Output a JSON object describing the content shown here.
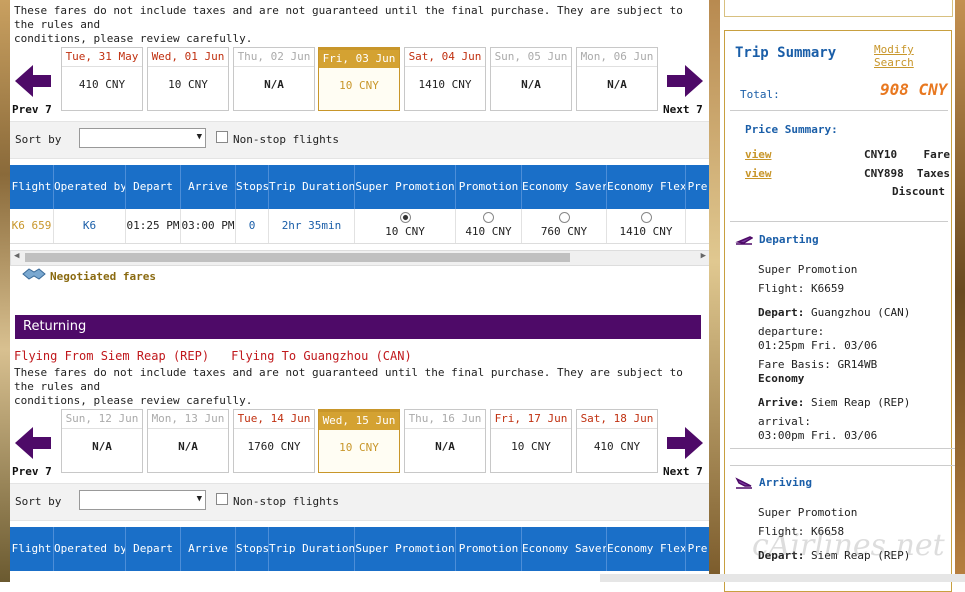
{
  "notice": {
    "line1": "These fares do not include taxes and are not guaranteed until the final purchase. They are subject to the rules and",
    "line2": "conditions, please review carefully."
  },
  "nav": {
    "prev": "Prev 7",
    "next": "Next 7"
  },
  "departing_dates": [
    {
      "date": "Tue, 31 May",
      "price": "410 CNY",
      "available": true,
      "selected": false
    },
    {
      "date": "Wed, 01 Jun",
      "price": "10 CNY",
      "available": true,
      "selected": false
    },
    {
      "date": "Thu, 02 Jun",
      "price": "N/A",
      "available": false,
      "selected": false
    },
    {
      "date": "Fri, 03 Jun",
      "price": "10 CNY",
      "available": true,
      "selected": true
    },
    {
      "date": "Sat, 04 Jun",
      "price": "1410 CNY",
      "available": true,
      "selected": false
    },
    {
      "date": "Sun, 05 Jun",
      "price": "N/A",
      "available": false,
      "selected": false
    },
    {
      "date": "Mon, 06 Jun",
      "price": "N/A",
      "available": false,
      "selected": false
    }
  ],
  "returning_dates": [
    {
      "date": "Sun, 12 Jun",
      "price": "N/A",
      "available": false,
      "selected": false
    },
    {
      "date": "Mon, 13 Jun",
      "price": "N/A",
      "available": false,
      "selected": false
    },
    {
      "date": "Tue, 14 Jun",
      "price": "1760 CNY",
      "available": true,
      "selected": false
    },
    {
      "date": "Wed, 15 Jun",
      "price": "10 CNY",
      "available": true,
      "selected": true
    },
    {
      "date": "Thu, 16 Jun",
      "price": "N/A",
      "available": false,
      "selected": false
    },
    {
      "date": "Fri, 17 Jun",
      "price": "10 CNY",
      "available": true,
      "selected": false
    },
    {
      "date": "Sat, 18 Jun",
      "price": "410 CNY",
      "available": true,
      "selected": false
    }
  ],
  "sort": {
    "label": "Sort by",
    "value": "",
    "nonstop_label": "Non-stop flights"
  },
  "table": {
    "headers": [
      "Flight",
      "Operated by",
      "Depart",
      "Arrive",
      "Stops",
      "Trip Duration",
      "Super Promotion",
      "Promotion",
      "Economy Saver",
      "Economy Flex",
      "Pre"
    ]
  },
  "flight": {
    "flight": "K6 659",
    "operated_by": "K6",
    "depart": "01:25 PM",
    "arrive": "03:00 PM",
    "stops": "0",
    "duration": "2hr 35min",
    "fares": [
      "10 CNY",
      "410 CNY",
      "760 CNY",
      "1410 CNY"
    ],
    "selected_fare": 0
  },
  "negotiated": "Negotiated fares",
  "returning": {
    "title": "Returning",
    "from": "Flying From Siem Reap (REP)",
    "to": "Flying To Guangzhou (CAN)"
  },
  "summary": {
    "title": "Trip Summary",
    "modify": "Modify Search",
    "total_label": "Total:",
    "total_value": "908 CNY",
    "price_title": "Price Summary:",
    "rows": [
      {
        "view": "view",
        "amount": "CNY10",
        "label": "Fare"
      },
      {
        "view": "view",
        "amount": "CNY898",
        "label": "Taxes"
      }
    ],
    "discount": "Discount",
    "departing": {
      "title": "Departing",
      "fare": "Super Promotion",
      "flight": "Flight: K6659",
      "depart_label": "Depart:",
      "depart_value": " Guangzhou (CAN)",
      "departure_label": "departure:",
      "departure_time": "01:25pm Fri. 03/06",
      "fare_basis": "Fare Basis: GR14WB",
      "cabin": "Economy",
      "arrive_label": "Arrive:",
      "arrive_value": " Siem Reap (REP)",
      "arrival_label": "arrival:",
      "arrival_time": "03:00pm Fri. 03/06"
    },
    "arriving": {
      "title": "Arriving",
      "fare": "Super Promotion",
      "flight": "Flight: K6658",
      "depart_label": "Depart:",
      "depart_value": " Siem Reap (REP)"
    }
  },
  "colors": {
    "blue": "#1a6fc8",
    "purple": "#4e0a68",
    "gold": "#d4a232",
    "red": "#c0181c",
    "orange": "#e87820"
  }
}
